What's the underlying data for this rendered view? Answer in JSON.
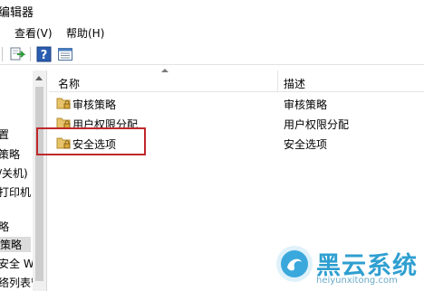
{
  "window": {
    "title_fragment": "编辑器"
  },
  "menu": {
    "items": [
      "查看(V)",
      "帮助(H)"
    ]
  },
  "toolbar": {
    "icons": [
      "export-icon",
      "help-icon",
      "properties-icon"
    ]
  },
  "left_pane": {
    "items": [
      "置",
      "策略",
      "/关机)",
      "打印机",
      "略",
      "策略",
      "安全 Wi",
      "络列表管理"
    ],
    "selected_index": 5
  },
  "list": {
    "columns": {
      "name": "名称",
      "description": "描述"
    },
    "rows": [
      {
        "name": "审核策略",
        "description": "审核策略"
      },
      {
        "name": "用户权限分配",
        "description": "用户权限分配"
      },
      {
        "name": "安全选项",
        "description": "安全选项",
        "highlighted": true
      }
    ]
  },
  "watermark": {
    "brand": "黑云系统",
    "site": "heiyunxitong.com"
  },
  "colors": {
    "highlight_border": "#c0282b",
    "brand": "#2f9fd0"
  }
}
